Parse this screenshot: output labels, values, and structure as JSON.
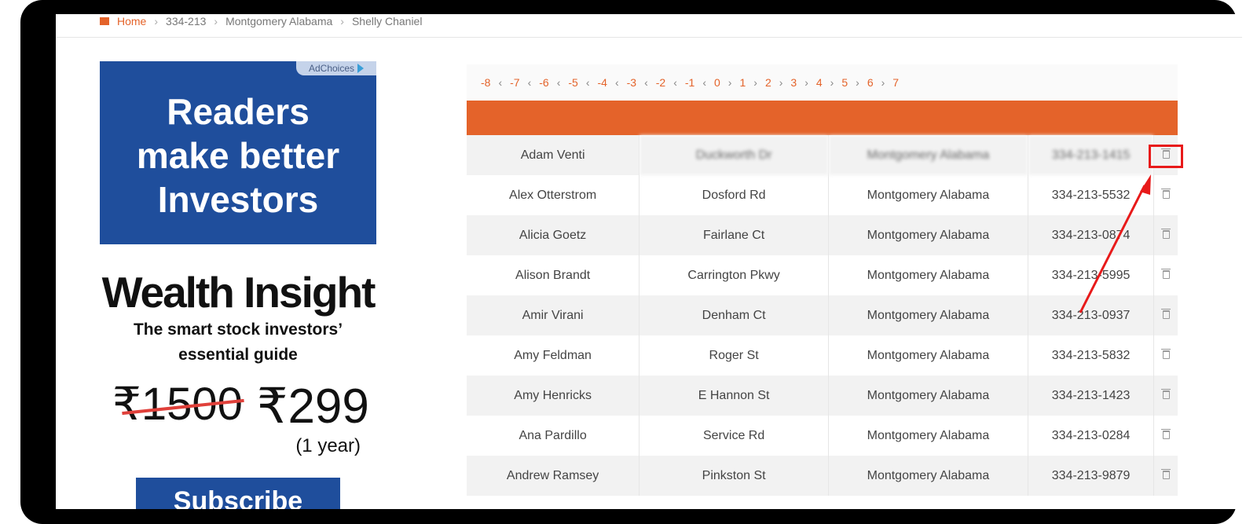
{
  "breadcrumb": {
    "home": "Home",
    "items": [
      "334-213",
      "Montgomery Alabama",
      "Shelly Chaniel"
    ]
  },
  "ad": {
    "adchoices": "AdChoices",
    "headline_lines": [
      "Readers",
      "make better",
      "Investors"
    ],
    "title": "Wealth Insight",
    "subtitle_lines": [
      "The smart stock investors’",
      "essential guide"
    ],
    "old_price": "₹1500",
    "new_price": "₹299",
    "period": "(1 year)",
    "cta": "Subscribe",
    "colors": {
      "brand": "#1f4e9c",
      "strike": "#e0403a"
    }
  },
  "pager": {
    "pages": [
      "-8",
      "-7",
      "-6",
      "-5",
      "-4",
      "-3",
      "-2",
      "-1",
      "0",
      "1",
      "2",
      "3",
      "4",
      "5",
      "6",
      "7"
    ],
    "current": "0",
    "accent": "#e4632a"
  },
  "table": {
    "rows": [
      {
        "name": "Adam Venti",
        "street": "Duckworth Dr",
        "city": "Montgomery Alabama",
        "phone": "334-213-1415",
        "blurred": true
      },
      {
        "name": "Alex Otterstrom",
        "street": "Dosford Rd",
        "city": "Montgomery Alabama",
        "phone": "334-213-5532"
      },
      {
        "name": "Alicia Goetz",
        "street": "Fairlane Ct",
        "city": "Montgomery Alabama",
        "phone": "334-213-0874"
      },
      {
        "name": "Alison Brandt",
        "street": "Carrington Pkwy",
        "city": "Montgomery Alabama",
        "phone": "334-213-5995"
      },
      {
        "name": "Amir Virani",
        "street": "Denham Ct",
        "city": "Montgomery Alabama",
        "phone": "334-213-0937"
      },
      {
        "name": "Amy Feldman",
        "street": "Roger St",
        "city": "Montgomery Alabama",
        "phone": "334-213-5832"
      },
      {
        "name": "Amy Henricks",
        "street": "E Hannon St",
        "city": "Montgomery Alabama",
        "phone": "334-213-1423"
      },
      {
        "name": "Ana Pardillo",
        "street": "Service Rd",
        "city": "Montgomery Alabama",
        "phone": "334-213-0284"
      },
      {
        "name": "Andrew Ramsey",
        "street": "Pinkston St",
        "city": "Montgomery Alabama",
        "phone": "334-213-9879"
      }
    ]
  },
  "annotation": {
    "color": "#e81a1a",
    "icon": "trash-icon"
  }
}
